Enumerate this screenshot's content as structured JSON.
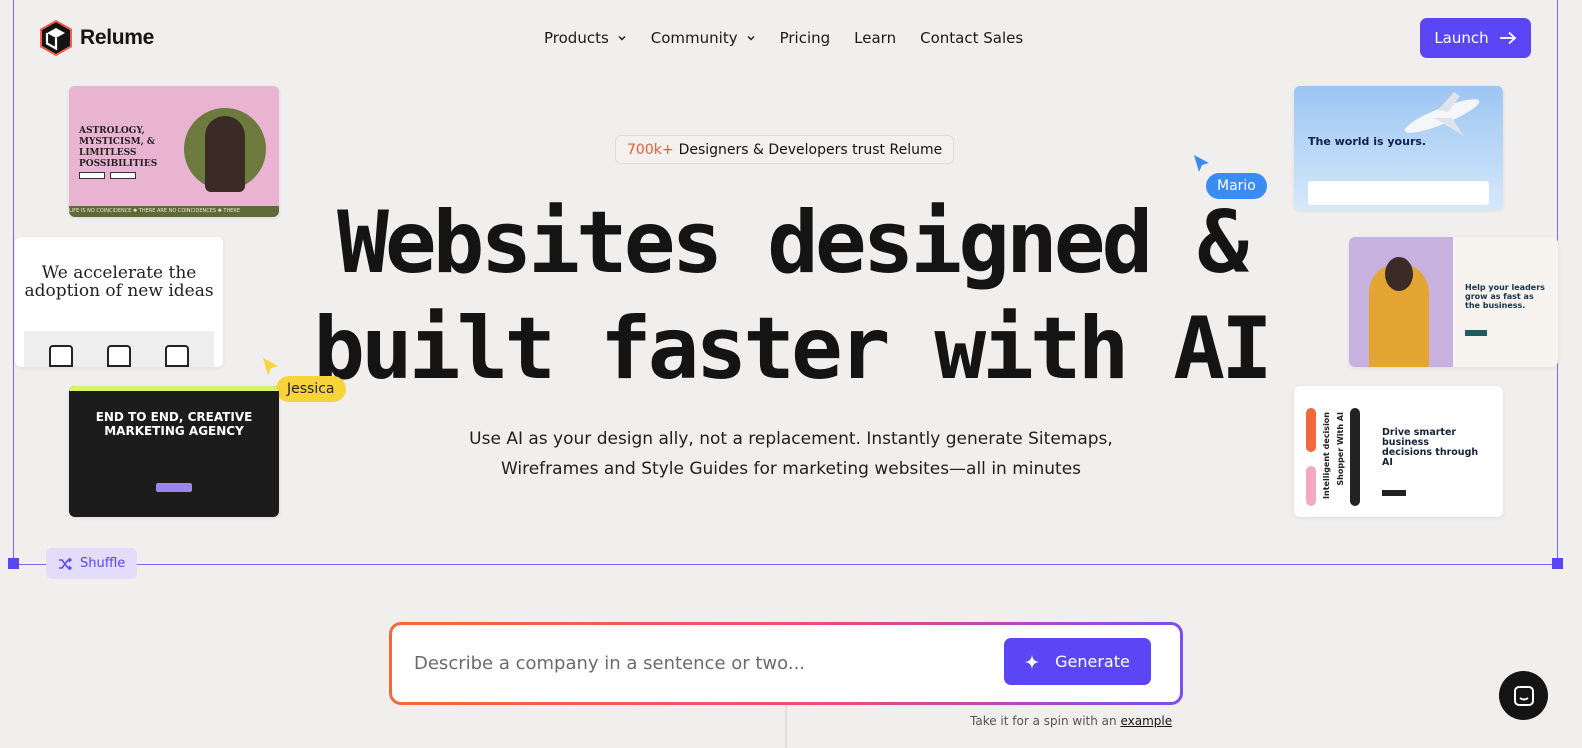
{
  "brand": {
    "name": "Relume"
  },
  "nav": {
    "items": [
      {
        "label": "Products",
        "dropdown": true
      },
      {
        "label": "Community",
        "dropdown": true
      },
      {
        "label": "Pricing",
        "dropdown": false
      },
      {
        "label": "Learn",
        "dropdown": false
      },
      {
        "label": "Contact Sales",
        "dropdown": false
      }
    ],
    "launch_label": "Launch"
  },
  "hero": {
    "badge_highlight": "700k+",
    "badge_text": "Designers & Developers trust Relume",
    "headline_line1": "Websites designed &",
    "headline_line2": "built faster with AI",
    "subtext_line1": "Use AI as your design ally, not a replacement. Instantly generate Sitemaps,",
    "subtext_line2": "Wireframes and Style Guides for marketing websites—all in minutes"
  },
  "cursors": {
    "mario": "Mario",
    "jessica": "Jessica"
  },
  "thumbnails": {
    "t1": {
      "title": "ASTROLOGY, MYSTICISM, & LIMITLESS POSSIBILITIES",
      "ticker": "LIFE IS NO COINCIDENCE ✺ THERE ARE NO COINCIDENCES ✺ THERE"
    },
    "t2": {
      "title": "We accelerate the adoption of new ideas"
    },
    "t3": {
      "title": "END TO END, CREATIVE MARKETING AGENCY"
    },
    "t4": {
      "title": "The world is yours."
    },
    "t5": {
      "title": "Help your leaders grow as fast as the business."
    },
    "t6": {
      "title": "Drive smarter business decisions through AI",
      "vertical_1": "Intelligent decision",
      "vertical_2": "Shopper With AI"
    }
  },
  "shuffle_label": "Shuffle",
  "generator": {
    "placeholder": "Describe a company in a sentence or two...",
    "button_label": "Generate",
    "hint_prefix": "Take it for a spin with an",
    "hint_link": "example"
  },
  "colors": {
    "accent": "#5b46f5",
    "background": "#f0efee",
    "badge_highlight": "#ee5a38",
    "mario": "#3a8cf5",
    "jessica": "#f7d43a"
  },
  "icons": {
    "logo": "relume-cube-logo",
    "launch": "arrow-right-icon",
    "shuffle": "shuffle-icon",
    "generate": "sparkle-icon",
    "chat": "chat-icon"
  }
}
